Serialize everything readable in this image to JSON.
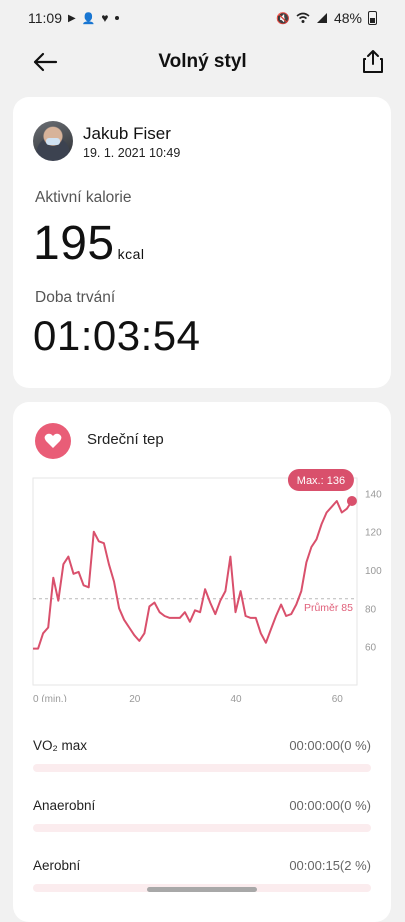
{
  "status_bar": {
    "time": "11:09",
    "battery": "48%"
  },
  "app_bar": {
    "title": "Volný styl"
  },
  "summary": {
    "user_name": "Jakub Fiser",
    "date": "19. 1. 2021 10:49",
    "calories_label": "Aktivní kalorie",
    "calories_value": "195",
    "calories_unit": "kcal",
    "duration_label": "Doba trvání",
    "duration_value": "01:03:54"
  },
  "heart_rate": {
    "title": "Srdeční tep",
    "max_badge": "Max.: 136",
    "avg_label": "Průměr 85"
  },
  "chart_data": {
    "type": "line",
    "xlabel": "",
    "ylabel": "",
    "x_tick_labels": [
      "0 (min.)",
      "20",
      "40",
      "60"
    ],
    "x_ticks": [
      0,
      20,
      40,
      60
    ],
    "y_ticks": [
      60,
      80,
      100,
      120,
      140
    ],
    "xlim": [
      0,
      64
    ],
    "ylim": [
      40,
      148
    ],
    "average": 85,
    "max": 136,
    "color": "#d9506c",
    "series": [
      {
        "x": [
          0,
          1,
          2,
          3,
          4,
          5,
          6,
          7,
          8,
          9,
          10,
          11,
          12,
          13,
          14,
          15,
          16,
          17,
          18,
          19,
          20,
          21,
          22,
          23,
          24,
          25,
          26,
          27,
          28,
          29,
          30,
          31,
          32,
          33,
          34,
          35,
          36,
          37,
          38,
          39,
          40,
          41,
          42,
          43,
          44,
          45,
          46,
          47,
          48,
          49,
          50,
          51,
          52,
          53,
          54,
          55,
          56,
          57,
          58,
          59,
          60,
          61,
          62,
          63
        ],
        "y": [
          59,
          59,
          67,
          70,
          96,
          84,
          103,
          107,
          98,
          99,
          92,
          91,
          120,
          115,
          114,
          103,
          94,
          80,
          74,
          70,
          66,
          63,
          67,
          81,
          83,
          78,
          76,
          75,
          75,
          75,
          78,
          73,
          79,
          78,
          90,
          83,
          77,
          84,
          89,
          107,
          78,
          89,
          76,
          75,
          75,
          67,
          62,
          69,
          76,
          82,
          76,
          77,
          82,
          89,
          104,
          112,
          116,
          124,
          130,
          133,
          136,
          130,
          132,
          136
        ]
      }
    ]
  },
  "zones": [
    {
      "name": "VO₂ max",
      "time": "00:00:00(0 %)"
    },
    {
      "name": "Anaerobní",
      "time": "00:00:00(0 %)"
    },
    {
      "name": "Aerobní",
      "time": "00:00:15(2 %)"
    }
  ]
}
